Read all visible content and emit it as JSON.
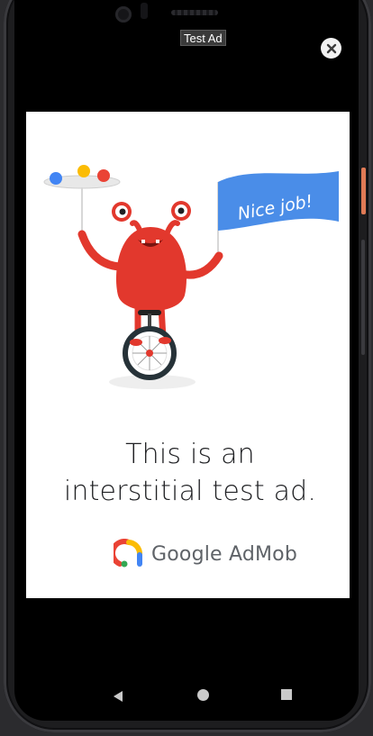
{
  "ad": {
    "label": "Test Ad",
    "headline_line1": "This is an",
    "headline_line2": "interstitial test ad.",
    "flag_text": "Nice job!",
    "brand_text": "Google AdMob"
  },
  "nav": {
    "back_icon": "back-triangle-icon",
    "home_icon": "home-circle-icon",
    "recents_icon": "recents-square-icon"
  },
  "colors": {
    "monster_red": "#e2382d",
    "flag_blue": "#4a8de8",
    "screen_black": "#000000",
    "headline_text": "#202124",
    "brand_text": "#5f6368"
  }
}
